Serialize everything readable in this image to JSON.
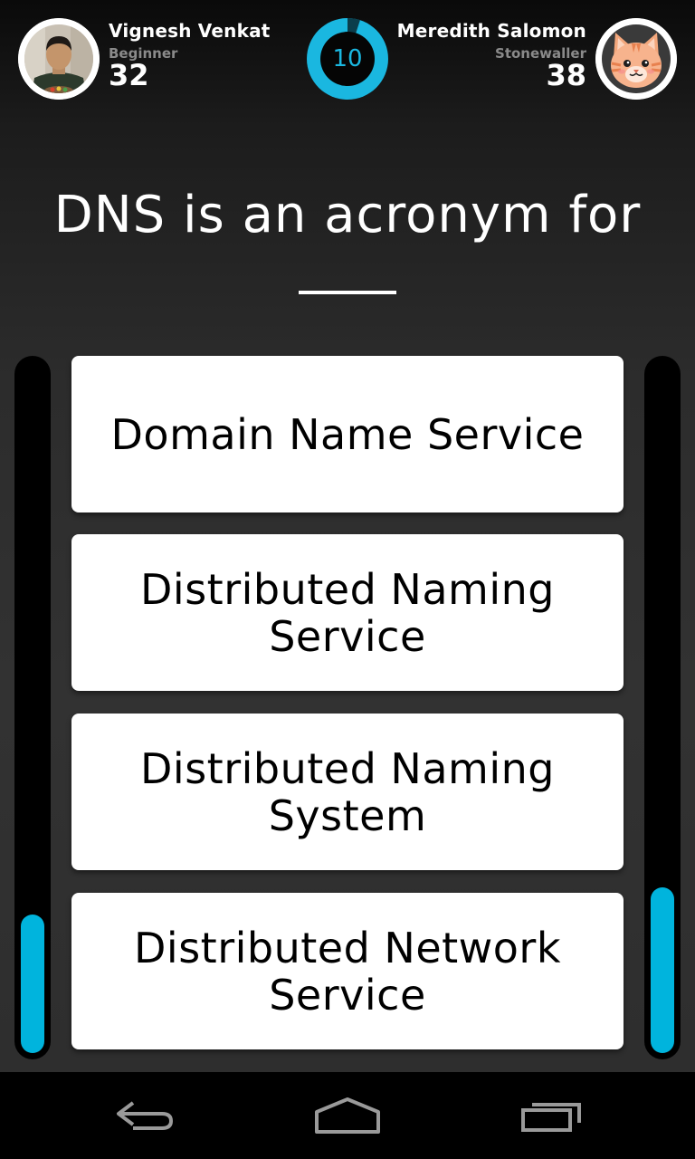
{
  "header": {
    "player1": {
      "name": "Vignesh Venkat",
      "rank": "Beginner",
      "score": "32",
      "avatar_icon": "player-photo"
    },
    "player2": {
      "name": "Meredith Salomon",
      "rank": "Stonewaller",
      "score": "38",
      "avatar_icon": "cat-face-icon"
    },
    "timer": {
      "value": "10",
      "remaining_fraction": 0.95,
      "color": "#1ab7e0"
    }
  },
  "question": {
    "text": "DNS is an acronym for"
  },
  "answers": [
    {
      "label": "Domain Name Service"
    },
    {
      "label": "Distributed Naming Service"
    },
    {
      "label": "Distributed Naming System"
    },
    {
      "label": "Distributed Network Service"
    }
  ],
  "score_bars": {
    "left_fraction": 0.2,
    "right_fraction": 0.24,
    "color": "#00b4dd"
  },
  "navbar": {
    "back_icon": "back-icon",
    "home_icon": "home-icon",
    "recents_icon": "recents-icon"
  }
}
